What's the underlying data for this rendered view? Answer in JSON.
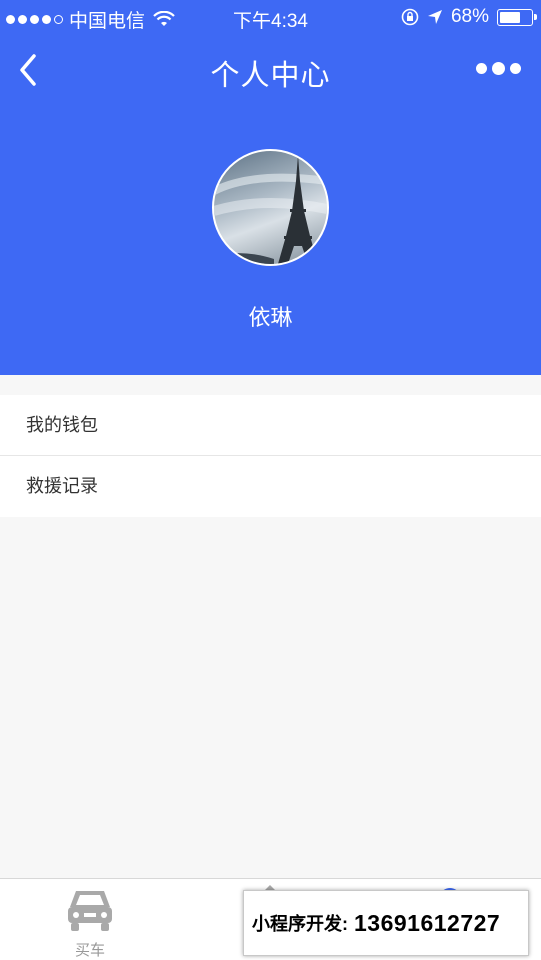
{
  "status_bar": {
    "carrier": "中国电信",
    "time": "下午4:34",
    "battery": "68%",
    "battery_level": 0.68,
    "icons": [
      "wifi-icon",
      "rotation-lock-icon",
      "location-arrow-icon",
      "battery-icon"
    ]
  },
  "nav": {
    "title": "个人中心",
    "back_icon": "chevron-left-icon",
    "more_icon": "more-dots-icon"
  },
  "profile": {
    "username": "依琳"
  },
  "menu": {
    "items": [
      {
        "label": "我的钱包"
      },
      {
        "label": "救援记录"
      }
    ]
  },
  "tab_bar": {
    "tabs": [
      {
        "label": "买车",
        "icon": "car-icon"
      }
    ]
  },
  "overlay": {
    "label": "小程序开发:",
    "phone": "13691612727"
  },
  "colors": {
    "header_bg": "#3e69f4",
    "page_bg": "#f7f7f7"
  }
}
